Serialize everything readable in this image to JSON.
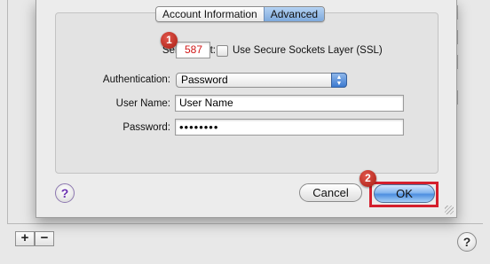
{
  "tabs": {
    "account_info": "Account Information",
    "advanced": "Advanced"
  },
  "form": {
    "server_port_label": "Server port:",
    "server_port_value": "587",
    "ssl_label": "Use Secure Sockets Layer (SSL)",
    "authentication_label": "Authentication:",
    "authentication_value": "Password",
    "username_label": "User Name:",
    "username_value": "User Name",
    "password_label": "Password:",
    "password_value": "••••••••"
  },
  "buttons": {
    "help": "?",
    "cancel": "Cancel",
    "ok": "OK",
    "add": "+",
    "remove": "−"
  },
  "steps": {
    "step1": "1",
    "step2": "2"
  },
  "colors": {
    "highlight": "#d41f2d",
    "port_text": "#d01515"
  },
  "icons": {
    "help": "question-mark-icon",
    "popup_arrows": "updown-arrows-icon"
  }
}
